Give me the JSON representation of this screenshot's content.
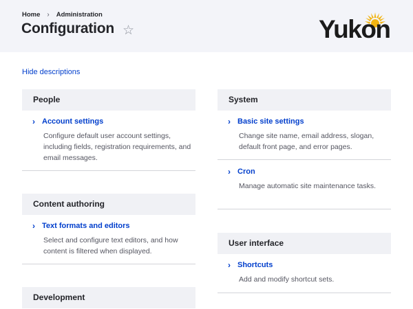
{
  "header": {
    "breadcrumb": [
      "Home",
      "Administration"
    ],
    "breadcrumb_separator": "›",
    "title": "Configuration",
    "star": "☆",
    "logo_text": "Yukon"
  },
  "toggle_descriptions_label": "Hide descriptions",
  "left_column": [
    {
      "title": "People",
      "items": [
        {
          "label": "Account settings",
          "description": "Configure default user account settings, including fields, registration requirements, and email messages."
        }
      ]
    },
    {
      "title": "Content authoring",
      "items": [
        {
          "label": "Text formats and editors",
          "description": "Select and configure text editors, and how content is filtered when displayed."
        }
      ]
    },
    {
      "title": "Development",
      "items": []
    }
  ],
  "right_column": [
    {
      "title": "System",
      "items": [
        {
          "label": "Basic site settings",
          "description": "Change site name, email address, slogan, default front page, and error pages."
        },
        {
          "label": "Cron",
          "description": "Manage automatic site maintenance tasks."
        }
      ]
    },
    {
      "title": "User interface",
      "items": [
        {
          "label": "Shortcuts",
          "description": "Add and modify shortcut sets."
        }
      ]
    }
  ],
  "chevron": "›",
  "colors": {
    "link": "#003ecc",
    "header_bg": "#f3f4f9",
    "logo_sun": "#f2b413"
  }
}
